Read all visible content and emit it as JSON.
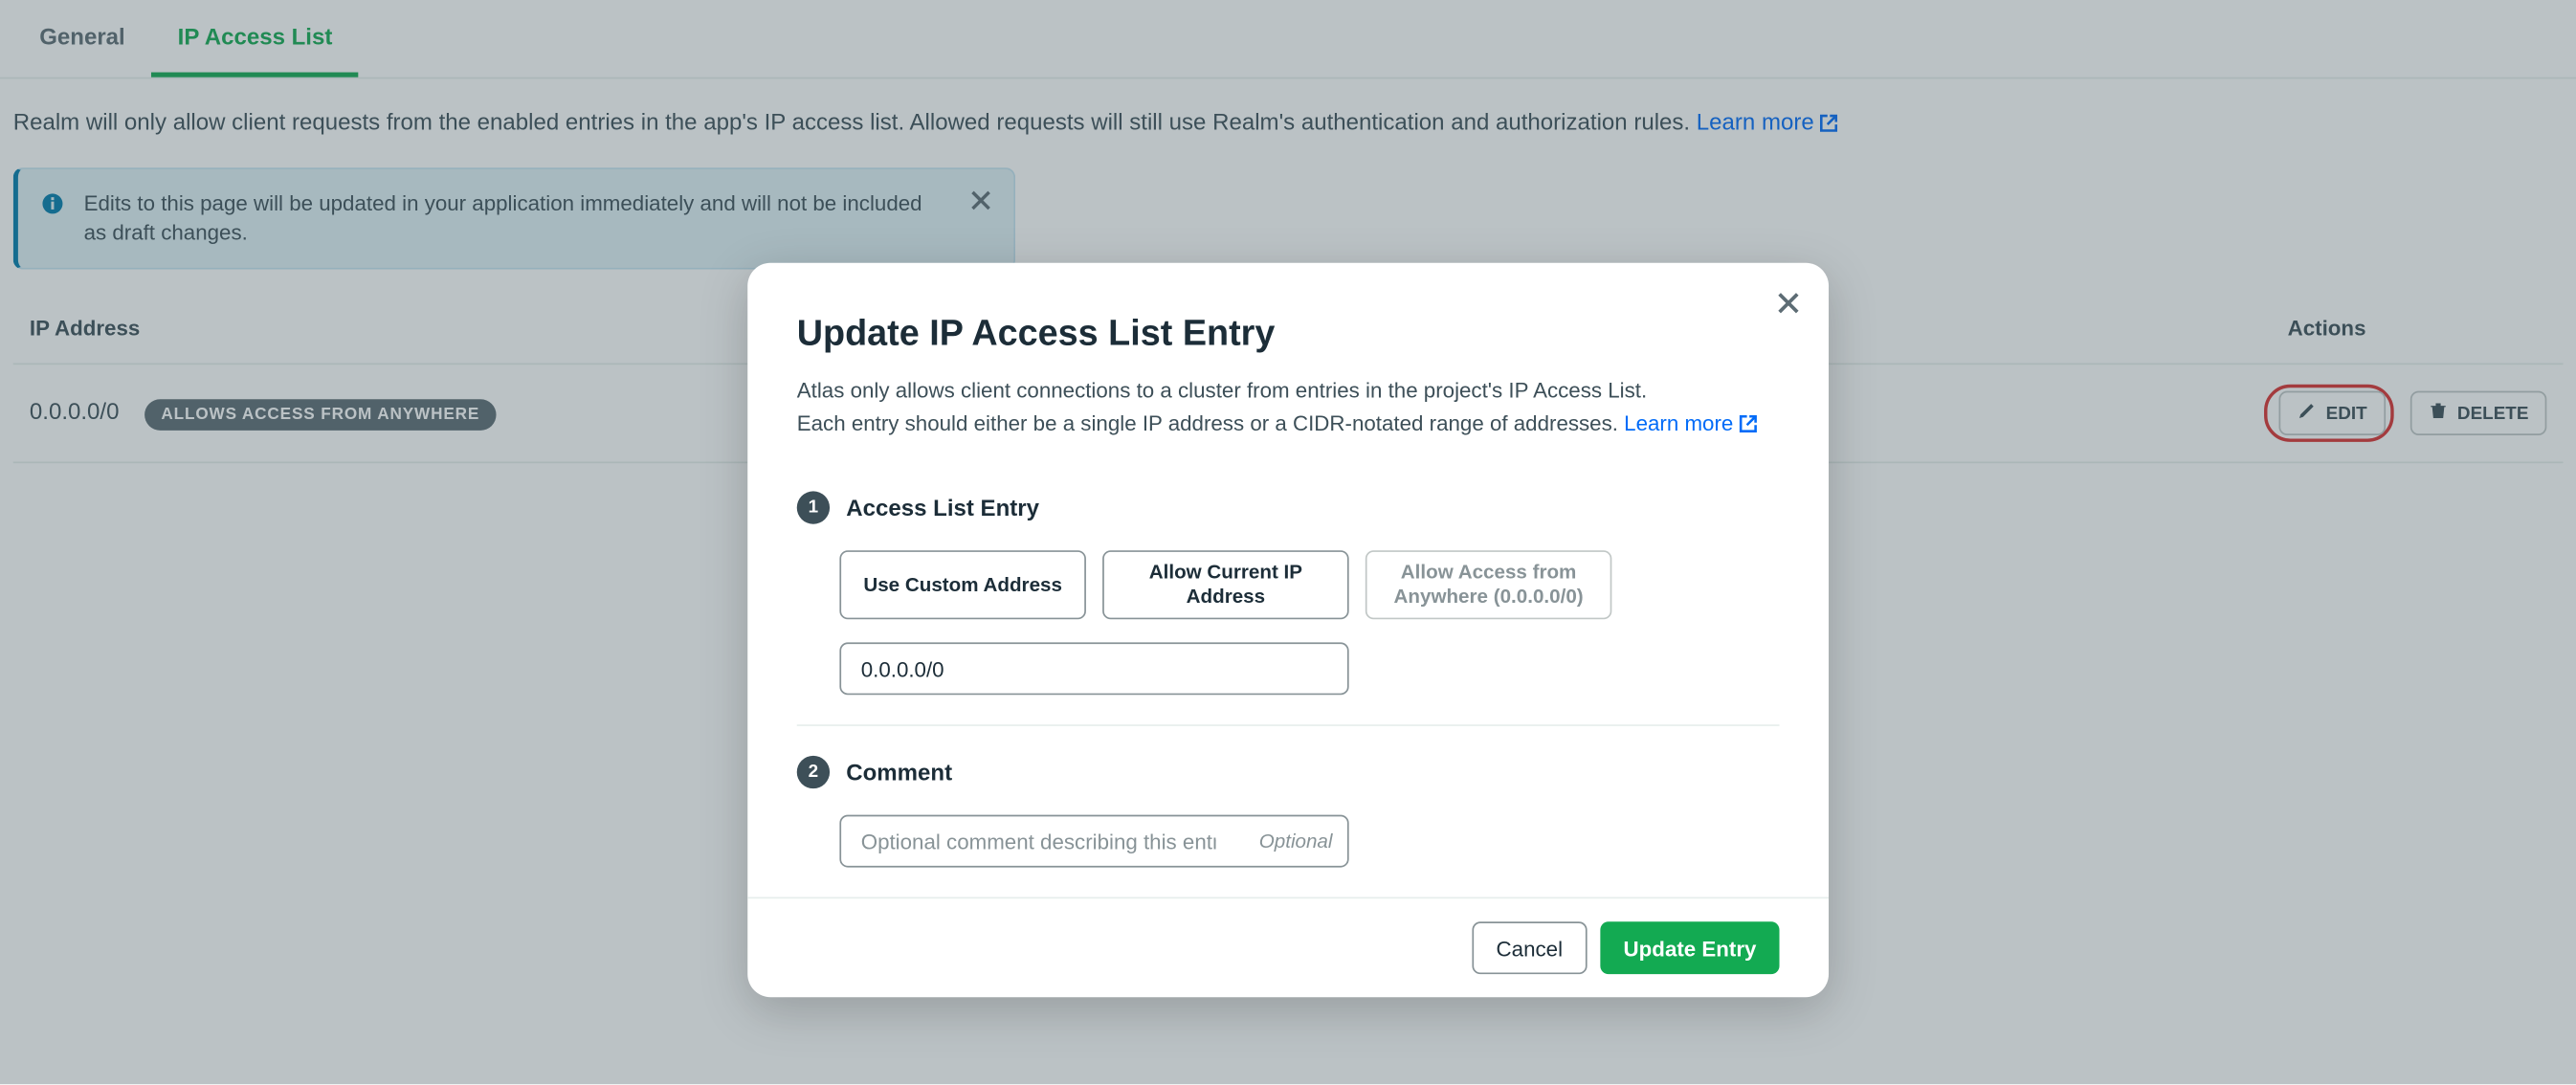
{
  "tabs": {
    "general": "General",
    "ip_access_list": "IP Access List"
  },
  "intro": {
    "text": "Realm will only allow client requests from the enabled entries in the app's IP access list. Allowed requests will still use Realm's authentication and authorization rules.",
    "learn_more": "Learn more"
  },
  "notice": {
    "text": "Edits to this page will be updated in your application immediately and will not be included as draft changes."
  },
  "table": {
    "cols": {
      "ip": "IP Address",
      "actions": "Actions"
    },
    "rows": [
      {
        "ip": "0.0.0.0/0",
        "badge": "ALLOWS ACCESS FROM ANYWHERE"
      }
    ],
    "edit_label": "EDIT",
    "delete_label": "DELETE"
  },
  "modal": {
    "title": "Update IP Access List Entry",
    "desc_line1": "Atlas only allows client connections to a cluster from entries in the project's IP Access List.",
    "desc_line2": "Each entry should either be a single IP address or a CIDR-notated range of addresses.",
    "learn_more": "Learn more",
    "step1_title": "Access List Entry",
    "btn_custom": "Use Custom Address",
    "btn_current": "Allow Current IP Address",
    "btn_anywhere": "Allow Access from Anywhere (0.0.0.0/0)",
    "ip_value": "0.0.0.0/0",
    "step2_title": "Comment",
    "comment_placeholder": "Optional comment describing this entry",
    "optional_label": "Optional",
    "cancel": "Cancel",
    "update": "Update Entry"
  }
}
